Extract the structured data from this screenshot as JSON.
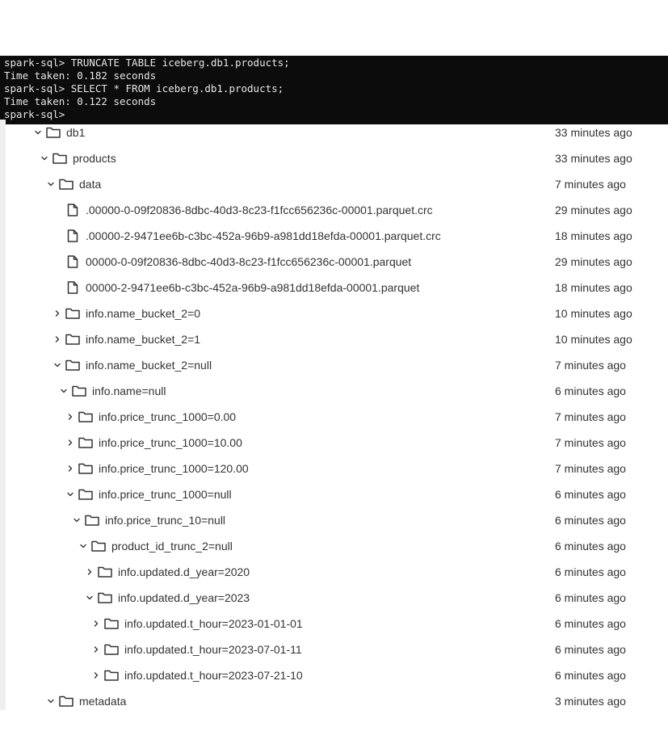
{
  "terminal": {
    "lines": [
      "spark-sql> TRUNCATE TABLE iceberg.db1.products;",
      "Time taken: 0.182 seconds",
      "spark-sql> SELECT * FROM iceberg.db1.products;",
      "Time taken: 0.122 seconds",
      "spark-sql> "
    ]
  },
  "tree": {
    "rows": [
      {
        "name": "db1",
        "modified": "33 minutes ago",
        "type": "folder",
        "expanded": true,
        "depth": 0
      },
      {
        "name": "products",
        "modified": "33 minutes ago",
        "type": "folder",
        "expanded": true,
        "depth": 1
      },
      {
        "name": "data",
        "modified": "7 minutes ago",
        "type": "folder",
        "expanded": true,
        "depth": 2
      },
      {
        "name": ".00000-0-09f20836-8dbc-40d3-8c23-f1fcc656236c-00001.parquet.crc",
        "modified": "29 minutes ago",
        "type": "file",
        "depth": 3
      },
      {
        "name": ".00000-2-9471ee6b-c3bc-452a-96b9-a981dd18efda-00001.parquet.crc",
        "modified": "18 minutes ago",
        "type": "file",
        "depth": 3
      },
      {
        "name": "00000-0-09f20836-8dbc-40d3-8c23-f1fcc656236c-00001.parquet",
        "modified": "29 minutes ago",
        "type": "file",
        "depth": 3
      },
      {
        "name": "00000-2-9471ee6b-c3bc-452a-96b9-a981dd18efda-00001.parquet",
        "modified": "18 minutes ago",
        "type": "file",
        "depth": 3
      },
      {
        "name": "info.name_bucket_2=0",
        "modified": "10 minutes ago",
        "type": "folder",
        "expanded": false,
        "depth": 3
      },
      {
        "name": "info.name_bucket_2=1",
        "modified": "10 minutes ago",
        "type": "folder",
        "expanded": false,
        "depth": 3
      },
      {
        "name": "info.name_bucket_2=null",
        "modified": "7 minutes ago",
        "type": "folder",
        "expanded": true,
        "depth": 3
      },
      {
        "name": "info.name=null",
        "modified": "6 minutes ago",
        "type": "folder",
        "expanded": true,
        "depth": 4
      },
      {
        "name": "info.price_trunc_1000=0.00",
        "modified": "7 minutes ago",
        "type": "folder",
        "expanded": false,
        "depth": 5
      },
      {
        "name": "info.price_trunc_1000=10.00",
        "modified": "7 minutes ago",
        "type": "folder",
        "expanded": false,
        "depth": 5
      },
      {
        "name": "info.price_trunc_1000=120.00",
        "modified": "7 minutes ago",
        "type": "folder",
        "expanded": false,
        "depth": 5
      },
      {
        "name": "info.price_trunc_1000=null",
        "modified": "6 minutes ago",
        "type": "folder",
        "expanded": true,
        "depth": 5
      },
      {
        "name": "info.price_trunc_10=null",
        "modified": "6 minutes ago",
        "type": "folder",
        "expanded": true,
        "depth": 6
      },
      {
        "name": "product_id_trunc_2=null",
        "modified": "6 minutes ago",
        "type": "folder",
        "expanded": true,
        "depth": 7
      },
      {
        "name": "info.updated.d_year=2020",
        "modified": "6 minutes ago",
        "type": "folder",
        "expanded": false,
        "depth": 8
      },
      {
        "name": "info.updated.d_year=2023",
        "modified": "6 minutes ago",
        "type": "folder",
        "expanded": true,
        "depth": 8
      },
      {
        "name": "info.updated.t_hour=2023-01-01-01",
        "modified": "6 minutes ago",
        "type": "folder",
        "expanded": false,
        "depth": 9
      },
      {
        "name": "info.updated.t_hour=2023-07-01-11",
        "modified": "6 minutes ago",
        "type": "folder",
        "expanded": false,
        "depth": 9
      },
      {
        "name": "info.updated.t_hour=2023-07-21-10",
        "modified": "6 minutes ago",
        "type": "folder",
        "expanded": false,
        "depth": 9
      },
      {
        "name": "metadata",
        "modified": "3 minutes ago",
        "type": "folder",
        "expanded": true,
        "depth": 2
      }
    ]
  },
  "colors": {
    "terminal_bg": "#0c0c0c",
    "terminal_text": "#e6e6e6",
    "tree_text": "#333333"
  },
  "icons": {
    "folder": "folder-icon",
    "file": "file-icon",
    "expanded": "chevron-down-icon",
    "collapsed": "chevron-right-icon"
  }
}
